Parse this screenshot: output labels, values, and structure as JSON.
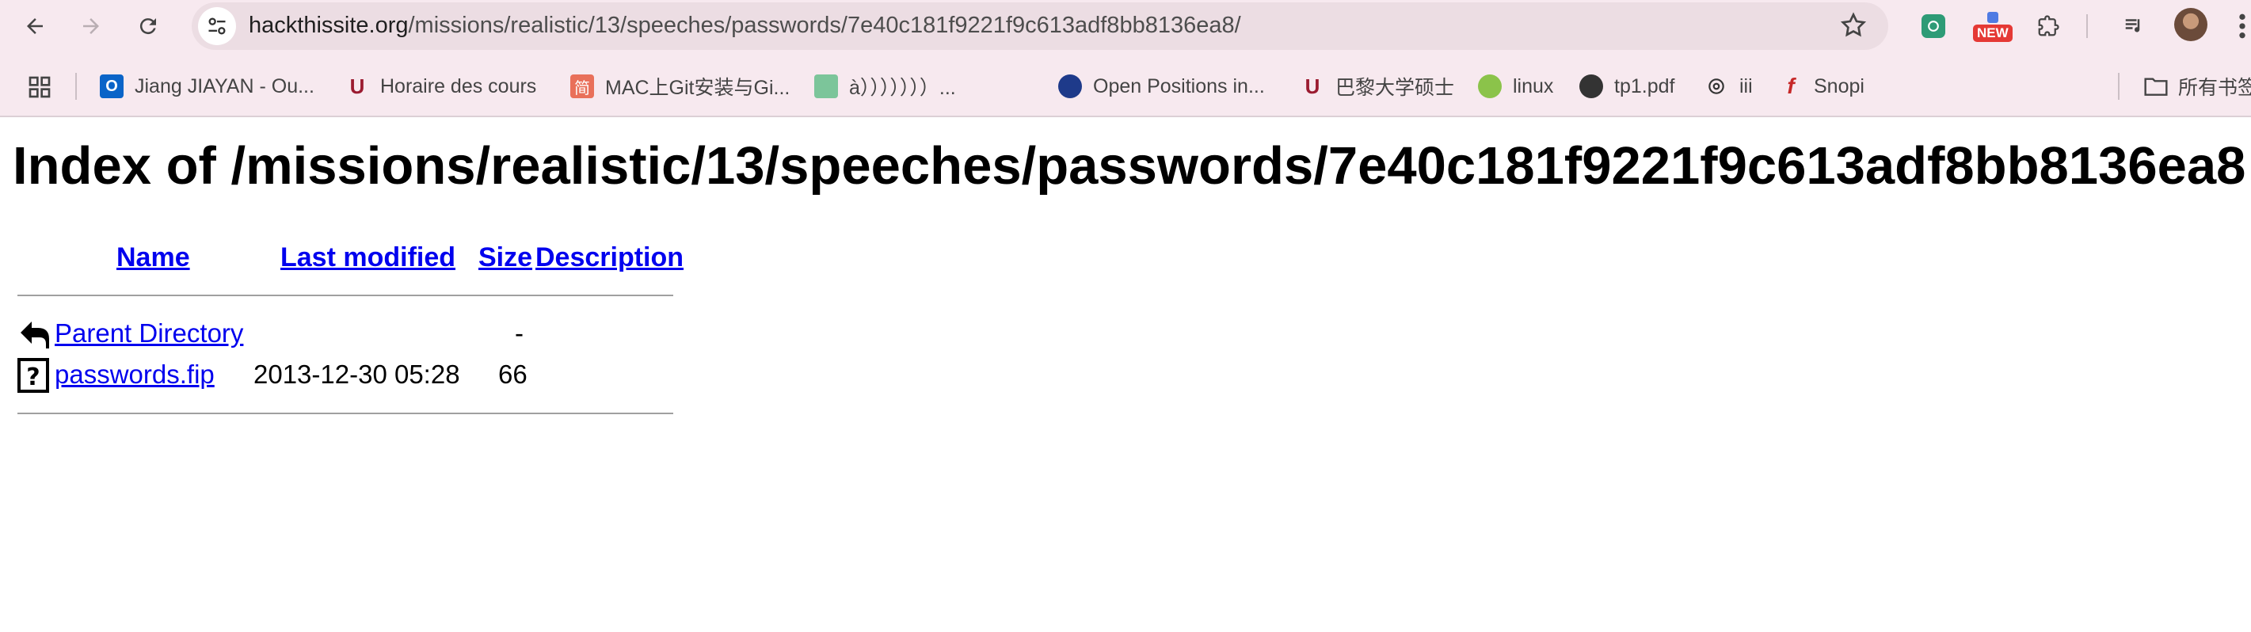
{
  "browser": {
    "url_host": "hackthissite.org",
    "url_path": "/missions/realistic/13/speeches/passwords/7e40c181f9221f9c613adf8bb8136ea8/",
    "extensions": [
      "openai-extension-icon",
      "new-badge-extension-icon",
      "puzzle-extensions-icon",
      "media-controls-icon"
    ],
    "new_badge": "NEW",
    "bookmarks": [
      {
        "label": "Jiang JIAYAN - Ou...",
        "icon": "outlook-icon",
        "color": "#0a64c8"
      },
      {
        "label": "Horaire des cours",
        "icon": "university-logo-icon",
        "color": "#9b1b30"
      },
      {
        "label": "MAC上Git安装与Gi...",
        "icon": "jianshu-icon",
        "color": "#e9705a"
      },
      {
        "label": "à）））））））...",
        "icon": "app-icon",
        "color": "#7cc59a"
      },
      {
        "label": "Open Positions in...",
        "icon": "globe-blue-icon",
        "color": "#1e3a8a"
      },
      {
        "label": "巴黎大学硕士",
        "icon": "university-logo-icon",
        "color": "#9b1b30"
      },
      {
        "label": "linux",
        "icon": "linux-icon",
        "color": "#8bc34a"
      },
      {
        "label": "tp1.pdf",
        "icon": "globe-icon",
        "color": "#333333"
      },
      {
        "label": "iii",
        "icon": "openai-icon",
        "color": "#333333"
      },
      {
        "label": "Snopi",
        "icon": "flash-icon",
        "color": "#c62828"
      }
    ],
    "folder_bookmark": "所有书签"
  },
  "page": {
    "title": "Index of /missions/realistic/13/speeches/passwords/7e40c181f9221f9c613adf8bb8136ea8",
    "columns": {
      "name": "Name",
      "last_modified": "Last modified",
      "size": "Size",
      "description": "Description"
    },
    "rows": [
      {
        "name": "Parent Directory",
        "modified": "",
        "size": "-",
        "description": "",
        "icon": "back-arrow-icon"
      },
      {
        "name": "passwords.fip",
        "modified": "2013-12-30 05:28",
        "size": "66",
        "description": "",
        "icon": "unknown-file-icon"
      }
    ]
  }
}
